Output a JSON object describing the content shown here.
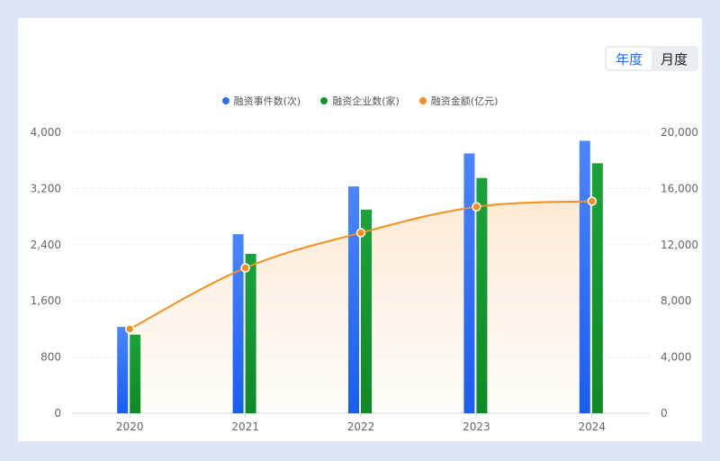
{
  "toggle": {
    "year_label": "年度",
    "month_label": "月度",
    "active": "year"
  },
  "colors": {
    "events": "#2f6df6",
    "companies": "#13952c",
    "amount": "#f5901e",
    "grid": "#e6e9ef"
  },
  "chart_data": {
    "type": "bar",
    "categories": [
      "2020",
      "2021",
      "2022",
      "2023",
      "2024"
    ],
    "series": [
      {
        "name": "融资事件数(次)",
        "type": "bar",
        "axis": "left",
        "values": [
          1230,
          2550,
          3230,
          3700,
          3880
        ]
      },
      {
        "name": "融资企业数(家)",
        "type": "bar",
        "axis": "left",
        "values": [
          1120,
          2270,
          2900,
          3350,
          3560
        ]
      },
      {
        "name": "融资金额(亿元)",
        "type": "line",
        "axis": "right",
        "values": [
          6000,
          10350,
          12850,
          14700,
          15100
        ]
      }
    ],
    "y_left": {
      "min": 0,
      "max": 4000,
      "ticks": [
        "0",
        "800",
        "1,600",
        "2,400",
        "3,200",
        "4,000"
      ]
    },
    "y_right": {
      "min": 0,
      "max": 20000,
      "ticks": [
        "0",
        "4,000",
        "8,000",
        "12,000",
        "16,000",
        "20,000"
      ]
    },
    "legend_position": "top-center",
    "grid": true
  }
}
